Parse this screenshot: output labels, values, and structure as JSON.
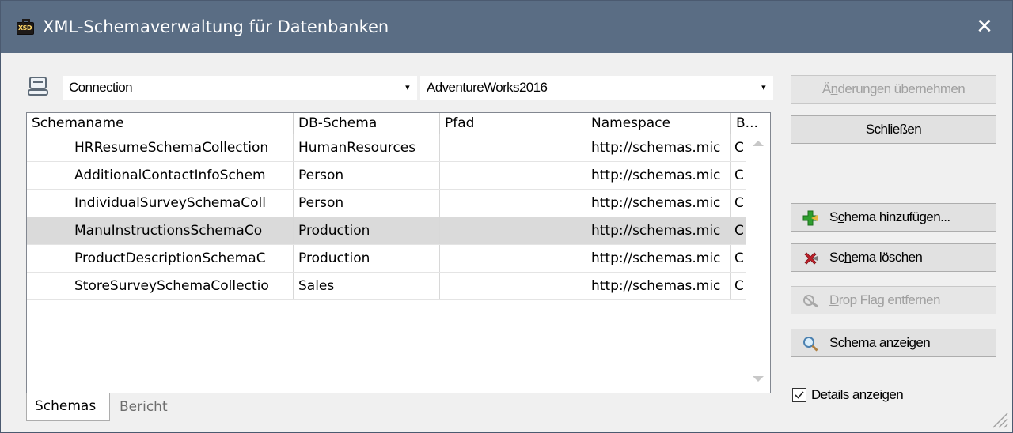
{
  "window": {
    "title": "XML-Schemaverwaltung für Datenbanken",
    "title_icon_text": "XSD",
    "close_symbol": "✕"
  },
  "toolbar": {
    "connection_combo": "Connection",
    "database_combo": "AdventureWorks2016",
    "dropdown_arrow": "▾"
  },
  "grid": {
    "columns": [
      "Schemaname",
      "DB-Schema",
      "Pfad",
      "Namespace",
      "B..."
    ],
    "rows": [
      {
        "name": "HRResumeSchemaCollection",
        "db": "HumanResources",
        "path": "",
        "ns": "http://schemas.mic",
        "b": "C"
      },
      {
        "name": "AdditionalContactInfoSchem",
        "db": "Person",
        "path": "",
        "ns": "http://schemas.mic",
        "b": "C"
      },
      {
        "name": "IndividualSurveySchemaColl",
        "db": "Person",
        "path": "",
        "ns": "http://schemas.mic",
        "b": "C"
      },
      {
        "name": "ManuInstructionsSchemaCo",
        "db": "Production",
        "path": "",
        "ns": "http://schemas.mic",
        "b": "C"
      },
      {
        "name": "ProductDescriptionSchemaC",
        "db": "Production",
        "path": "",
        "ns": "http://schemas.mic",
        "b": "C"
      },
      {
        "name": "StoreSurveySchemaCollectio",
        "db": "Sales",
        "path": "",
        "ns": "http://schemas.mic",
        "b": "C"
      }
    ],
    "selected_index": 3
  },
  "tabs": {
    "schemas": "Schemas",
    "bericht": "Bericht"
  },
  "buttons": {
    "apply_pre": "Ä",
    "apply_u": "n",
    "apply_post": "derungen übernehmen",
    "close": "Schließen",
    "add_pre": "S",
    "add_u": "c",
    "add_post": "hema hinzufügen...",
    "delete_pre": "Sc",
    "delete_u": "h",
    "delete_post": "ema löschen",
    "dropflag_u": "D",
    "dropflag_post": "rop Flag entfernen",
    "show_pre": "Sch",
    "show_u": "e",
    "show_post": "ma anzeigen"
  },
  "details": {
    "label": "Details anzeigen",
    "checked": true
  },
  "colors": {
    "titlebar": "#5a6d84",
    "selected_row": "#dadada",
    "add_icon": "#2e9e2e",
    "delete_icon": "#c0202a"
  }
}
